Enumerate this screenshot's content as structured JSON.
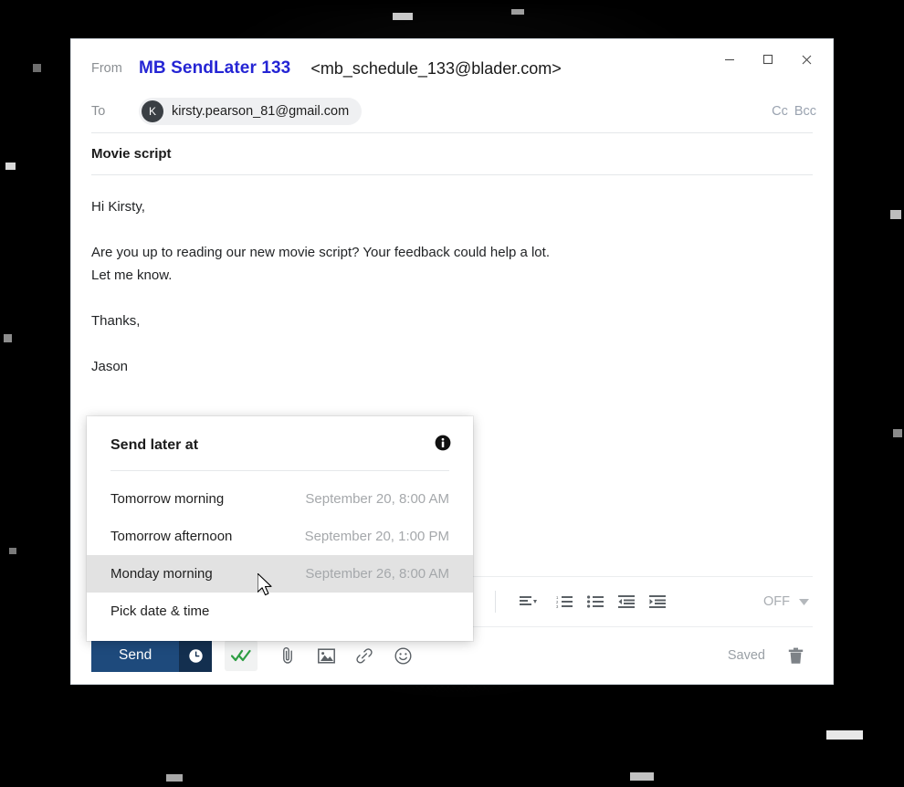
{
  "window": {
    "controls": [
      {
        "name": "minimize",
        "glyph": "minimize-icon"
      },
      {
        "name": "maximize",
        "glyph": "maximize-icon"
      },
      {
        "name": "close",
        "glyph": "close-icon"
      }
    ]
  },
  "header": {
    "from_label": "From",
    "from_name": "MB SendLater 133",
    "from_address": "<mb_schedule_133@blader.com>",
    "to_label": "To",
    "recipient_initial": "K",
    "recipient_email": "kirsty.pearson_81@gmail.com",
    "cc_label": "Cc",
    "bcc_label": "Bcc"
  },
  "subject": "Movie script",
  "body": {
    "greeting": "Hi Kirsty,",
    "paragraph_1": "Are you up to reading our new movie script? Your feedback could help a lot.",
    "paragraph_2": "Let me know.",
    "closing": "Thanks,",
    "signature": "Jason"
  },
  "format_toolbar": {
    "align_label": "align-left-icon",
    "numbered_list_label": "numbered-list-icon",
    "bullet_list_label": "bullet-list-icon",
    "outdent_label": "decrease-indent-icon",
    "indent_label": "increase-indent-icon",
    "off_label": "OFF"
  },
  "action_bar": {
    "send_label": "Send",
    "schedule_icon": "clock-icon",
    "tracking_icon": "double-check-icon",
    "attach_icon": "paperclip-icon",
    "image_icon": "image-icon",
    "link_icon": "link-icon",
    "emoji_icon": "emoji-icon",
    "saved_label": "Saved",
    "delete_icon": "trash-icon"
  },
  "send_later_panel": {
    "title": "Send later at",
    "info_icon": "info-icon",
    "options": [
      {
        "label": "Tomorrow morning",
        "date": "September 20, 8:00 AM",
        "highlighted": false
      },
      {
        "label": "Tomorrow afternoon",
        "date": "September 20, 1:00 PM",
        "highlighted": false
      },
      {
        "label": "Monday morning",
        "date": "September 26, 8:00 AM",
        "highlighted": true
      },
      {
        "label": "Pick date & time",
        "date": "",
        "highlighted": false
      }
    ]
  },
  "colors": {
    "send_button": "#1e4a7c",
    "send_schedule_button": "#132f4f",
    "from_name": "#2525d4",
    "tracking_check": "#2e9e43",
    "highlight_row": "#e2e2e2"
  }
}
